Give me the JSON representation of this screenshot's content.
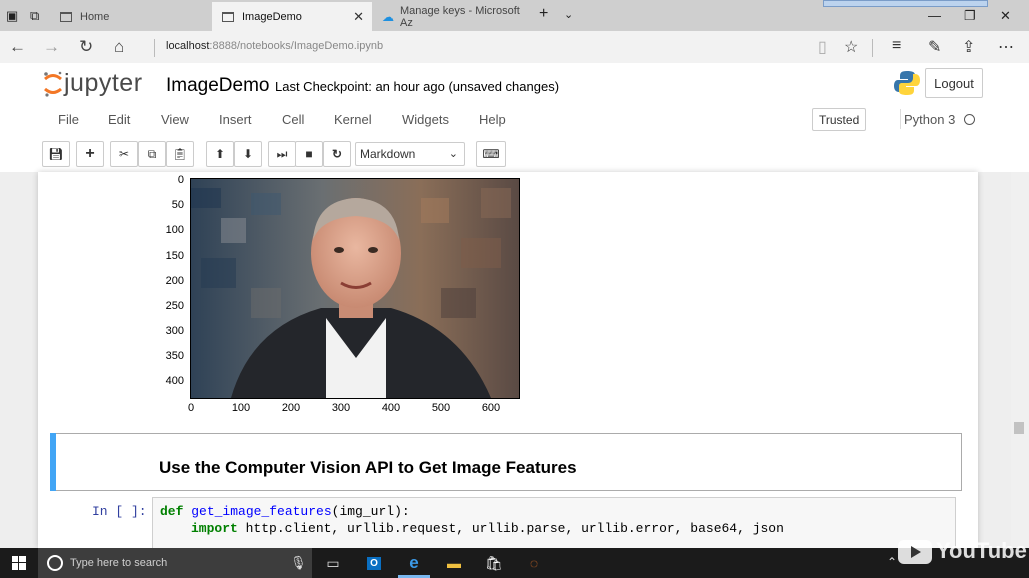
{
  "browser": {
    "tabs": [
      {
        "label": "Home"
      },
      {
        "label": "ImageDemo"
      },
      {
        "label": "Manage keys - Microsoft Az"
      }
    ],
    "url_host": "localhost",
    "url_rest": ":8888/notebooks/ImageDemo.ipynb"
  },
  "jupyter": {
    "logo_text": "jupyter",
    "notebook_name": "ImageDemo",
    "checkpoint": "Last Checkpoint: an hour ago (unsaved changes)",
    "logout_label": "Logout",
    "menu": [
      "File",
      "Edit",
      "View",
      "Insert",
      "Cell",
      "Kernel",
      "Widgets",
      "Help"
    ],
    "trusted_label": "Trusted",
    "kernel_name": "Python 3",
    "cell_type": "Markdown"
  },
  "plot": {
    "y_ticks": [
      "0",
      "50",
      "100",
      "150",
      "200",
      "250",
      "300",
      "350",
      "400"
    ],
    "x_ticks": [
      "0",
      "100",
      "200",
      "300",
      "400",
      "500",
      "600"
    ]
  },
  "markdown_cell": {
    "heading": "Use the Computer Vision API to Get Image Features"
  },
  "code_cell": {
    "prompt": "In [ ]:",
    "line1_kw": "def",
    "line1_fn": "get_image_features",
    "line1_rest": "(img_url):",
    "line2_kw": "import",
    "line2_rest": " http.client, urllib.request, urllib.parse, urllib.error, base64, json"
  },
  "taskbar": {
    "search_placeholder": "Type here to search"
  },
  "watermark": "YouTube"
}
